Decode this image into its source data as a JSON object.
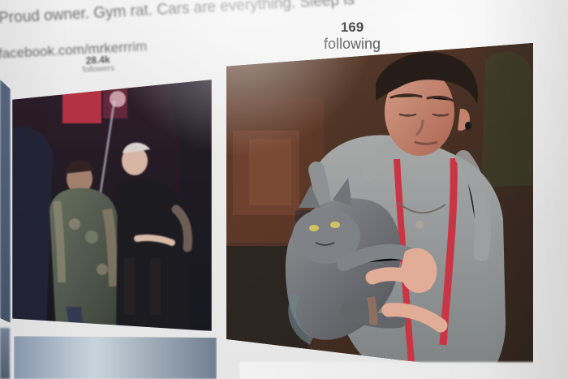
{
  "profile": {
    "bio_text": "Proud owner. Gym rat. Cars are everything. Sleep is",
    "link_text": "facebook.com/mrkerrrim"
  },
  "stats": {
    "followers_count": "28.4k",
    "followers_label": "followers",
    "following_count": "169",
    "following_label": "following"
  },
  "colors": {
    "screen_bg": "#ececec",
    "text_dark": "#3e3e3e",
    "text_muted": "#6f6f6f",
    "apron_red": "#c92f3f",
    "cat_gray": "#6e6f73"
  }
}
